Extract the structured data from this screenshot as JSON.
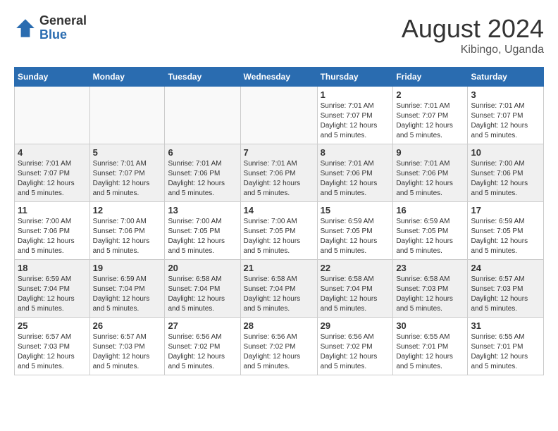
{
  "header": {
    "logo_general": "General",
    "logo_blue": "Blue",
    "month_year": "August 2024",
    "location": "Kibingo, Uganda"
  },
  "calendar": {
    "days_of_week": [
      "Sunday",
      "Monday",
      "Tuesday",
      "Wednesday",
      "Thursday",
      "Friday",
      "Saturday"
    ],
    "weeks": [
      {
        "days": [
          {
            "number": "",
            "info": ""
          },
          {
            "number": "",
            "info": ""
          },
          {
            "number": "",
            "info": ""
          },
          {
            "number": "",
            "info": ""
          },
          {
            "number": "1",
            "info": "Sunrise: 7:01 AM\nSunset: 7:07 PM\nDaylight: 12 hours and 5 minutes."
          },
          {
            "number": "2",
            "info": "Sunrise: 7:01 AM\nSunset: 7:07 PM\nDaylight: 12 hours and 5 minutes."
          },
          {
            "number": "3",
            "info": "Sunrise: 7:01 AM\nSunset: 7:07 PM\nDaylight: 12 hours and 5 minutes."
          }
        ]
      },
      {
        "days": [
          {
            "number": "4",
            "info": "Sunrise: 7:01 AM\nSunset: 7:07 PM\nDaylight: 12 hours and 5 minutes."
          },
          {
            "number": "5",
            "info": "Sunrise: 7:01 AM\nSunset: 7:07 PM\nDaylight: 12 hours and 5 minutes."
          },
          {
            "number": "6",
            "info": "Sunrise: 7:01 AM\nSunset: 7:06 PM\nDaylight: 12 hours and 5 minutes."
          },
          {
            "number": "7",
            "info": "Sunrise: 7:01 AM\nSunset: 7:06 PM\nDaylight: 12 hours and 5 minutes."
          },
          {
            "number": "8",
            "info": "Sunrise: 7:01 AM\nSunset: 7:06 PM\nDaylight: 12 hours and 5 minutes."
          },
          {
            "number": "9",
            "info": "Sunrise: 7:01 AM\nSunset: 7:06 PM\nDaylight: 12 hours and 5 minutes."
          },
          {
            "number": "10",
            "info": "Sunrise: 7:00 AM\nSunset: 7:06 PM\nDaylight: 12 hours and 5 minutes."
          }
        ]
      },
      {
        "days": [
          {
            "number": "11",
            "info": "Sunrise: 7:00 AM\nSunset: 7:06 PM\nDaylight: 12 hours and 5 minutes."
          },
          {
            "number": "12",
            "info": "Sunrise: 7:00 AM\nSunset: 7:06 PM\nDaylight: 12 hours and 5 minutes."
          },
          {
            "number": "13",
            "info": "Sunrise: 7:00 AM\nSunset: 7:05 PM\nDaylight: 12 hours and 5 minutes."
          },
          {
            "number": "14",
            "info": "Sunrise: 7:00 AM\nSunset: 7:05 PM\nDaylight: 12 hours and 5 minutes."
          },
          {
            "number": "15",
            "info": "Sunrise: 6:59 AM\nSunset: 7:05 PM\nDaylight: 12 hours and 5 minutes."
          },
          {
            "number": "16",
            "info": "Sunrise: 6:59 AM\nSunset: 7:05 PM\nDaylight: 12 hours and 5 minutes."
          },
          {
            "number": "17",
            "info": "Sunrise: 6:59 AM\nSunset: 7:05 PM\nDaylight: 12 hours and 5 minutes."
          }
        ]
      },
      {
        "days": [
          {
            "number": "18",
            "info": "Sunrise: 6:59 AM\nSunset: 7:04 PM\nDaylight: 12 hours and 5 minutes."
          },
          {
            "number": "19",
            "info": "Sunrise: 6:59 AM\nSunset: 7:04 PM\nDaylight: 12 hours and 5 minutes."
          },
          {
            "number": "20",
            "info": "Sunrise: 6:58 AM\nSunset: 7:04 PM\nDaylight: 12 hours and 5 minutes."
          },
          {
            "number": "21",
            "info": "Sunrise: 6:58 AM\nSunset: 7:04 PM\nDaylight: 12 hours and 5 minutes."
          },
          {
            "number": "22",
            "info": "Sunrise: 6:58 AM\nSunset: 7:04 PM\nDaylight: 12 hours and 5 minutes."
          },
          {
            "number": "23",
            "info": "Sunrise: 6:58 AM\nSunset: 7:03 PM\nDaylight: 12 hours and 5 minutes."
          },
          {
            "number": "24",
            "info": "Sunrise: 6:57 AM\nSunset: 7:03 PM\nDaylight: 12 hours and 5 minutes."
          }
        ]
      },
      {
        "days": [
          {
            "number": "25",
            "info": "Sunrise: 6:57 AM\nSunset: 7:03 PM\nDaylight: 12 hours and 5 minutes."
          },
          {
            "number": "26",
            "info": "Sunrise: 6:57 AM\nSunset: 7:03 PM\nDaylight: 12 hours and 5 minutes."
          },
          {
            "number": "27",
            "info": "Sunrise: 6:56 AM\nSunset: 7:02 PM\nDaylight: 12 hours and 5 minutes."
          },
          {
            "number": "28",
            "info": "Sunrise: 6:56 AM\nSunset: 7:02 PM\nDaylight: 12 hours and 5 minutes."
          },
          {
            "number": "29",
            "info": "Sunrise: 6:56 AM\nSunset: 7:02 PM\nDaylight: 12 hours and 5 minutes."
          },
          {
            "number": "30",
            "info": "Sunrise: 6:55 AM\nSunset: 7:01 PM\nDaylight: 12 hours and 5 minutes."
          },
          {
            "number": "31",
            "info": "Sunrise: 6:55 AM\nSunset: 7:01 PM\nDaylight: 12 hours and 5 minutes."
          }
        ]
      }
    ]
  }
}
